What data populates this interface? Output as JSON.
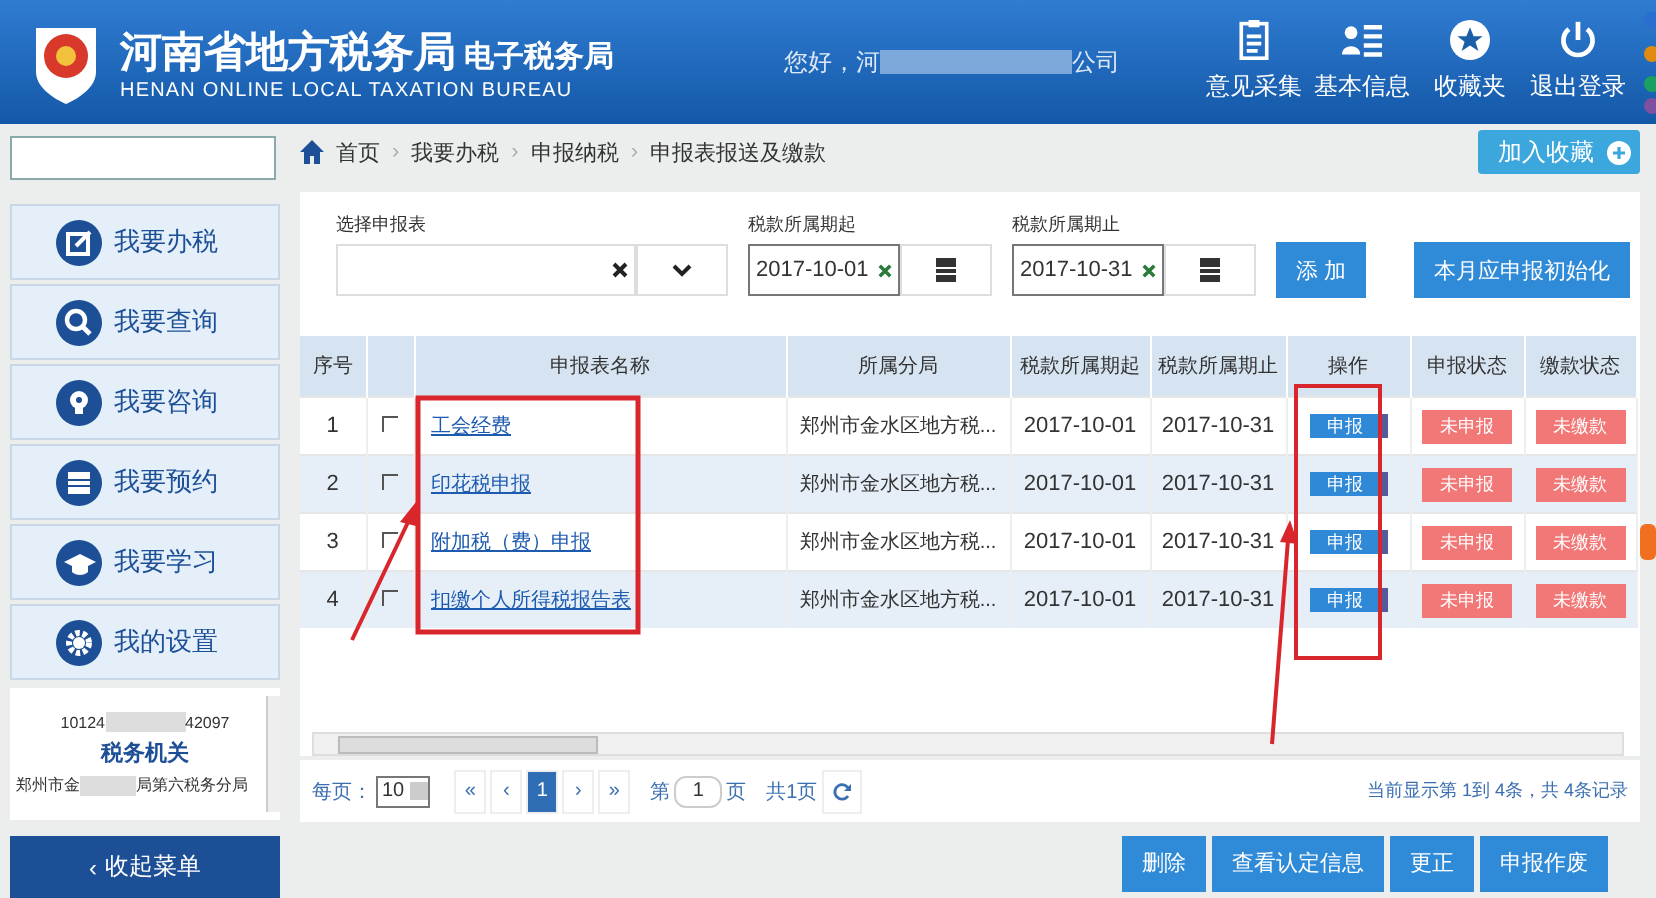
{
  "header": {
    "title": "河南省地方税务局",
    "title_suffix": "电子税务局",
    "subtitle": "HENAN ONLINE LOCAL TAXATION BUREAU",
    "greeting_prefix": "您好，河",
    "greeting_suffix": "公司",
    "actions": [
      {
        "kind": "clipboard",
        "label": "意见采集"
      },
      {
        "kind": "profile",
        "label": "基本信息"
      },
      {
        "kind": "star",
        "label": "收藏夹"
      },
      {
        "kind": "power",
        "label": "退出登录"
      }
    ]
  },
  "sidebar": {
    "items": [
      {
        "kind": "edit",
        "label": "我要办税"
      },
      {
        "kind": "search",
        "label": "我要查询"
      },
      {
        "kind": "bulb",
        "label": "我要咨询"
      },
      {
        "kind": "calendar",
        "label": "我要预约"
      },
      {
        "kind": "cap",
        "label": "我要学习"
      },
      {
        "kind": "gear",
        "label": "我的设置"
      }
    ],
    "info": {
      "id_prefix": "10124",
      "id_suffix": "42097",
      "org": "税务机关",
      "office_prefix": "郑州市金",
      "office_suffix": "局第六税务分局"
    },
    "collapse": {
      "arrow": "‹",
      "label": "收起菜单"
    }
  },
  "breadcrumb": {
    "separator": "›",
    "items": [
      "首页",
      "我要办税",
      "申报纳税",
      "申报表报送及缴款"
    ],
    "favorite_button": "加入收藏"
  },
  "filters": {
    "select_label": "选择申报表",
    "start_label": "税款所属期起",
    "start_value": "2017-10-01",
    "end_label": "税款所属期止",
    "end_value": "2017-10-31",
    "buttons": [
      "添 加",
      "本月应申报初始化"
    ]
  },
  "table": {
    "columns": [
      "序号",
      "申报表名称",
      "所属分局",
      "税款所属期起",
      "税款所属期止",
      "操作",
      "申报状态",
      "缴款状态"
    ],
    "rows": [
      {
        "index": "1",
        "checked": false,
        "name": "工会经费",
        "office": "郑州市金水区地方税...",
        "start": "2017-10-01",
        "end": "2017-10-31",
        "action": "申报",
        "declare_status": "未申报",
        "pay_status": "未缴款"
      },
      {
        "index": "2",
        "checked": false,
        "name": "印花税申报",
        "office": "郑州市金水区地方税...",
        "start": "2017-10-01",
        "end": "2017-10-31",
        "action": "申报",
        "declare_status": "未申报",
        "pay_status": "未缴款"
      },
      {
        "index": "3",
        "checked": false,
        "name": "附加税（费）申报",
        "office": "郑州市金水区地方税...",
        "start": "2017-10-01",
        "end": "2017-10-31",
        "action": "申报",
        "declare_status": "未申报",
        "pay_status": "未缴款"
      },
      {
        "index": "4",
        "checked": false,
        "name": "扣缴个人所得税报告表",
        "office": "郑州市金水区地方税...",
        "start": "2017-10-01",
        "end": "2017-10-31",
        "action": "申报",
        "declare_status": "未申报",
        "pay_status": "未缴款"
      }
    ]
  },
  "pagination": {
    "per_page_label": "每页：",
    "per_page": "10",
    "first": "«",
    "prev": "‹",
    "pages": [
      {
        "label": "1",
        "selected": true
      }
    ],
    "next": "›",
    "last": "»",
    "page_prefix": "第",
    "page_input": "1",
    "page_suffix": "页",
    "total_pages": "共1页",
    "summary": "当前显示第 1到 4条，共 4条记录"
  },
  "actions": [
    "删除",
    "查看认定信息",
    "更正",
    "申报作废"
  ]
}
